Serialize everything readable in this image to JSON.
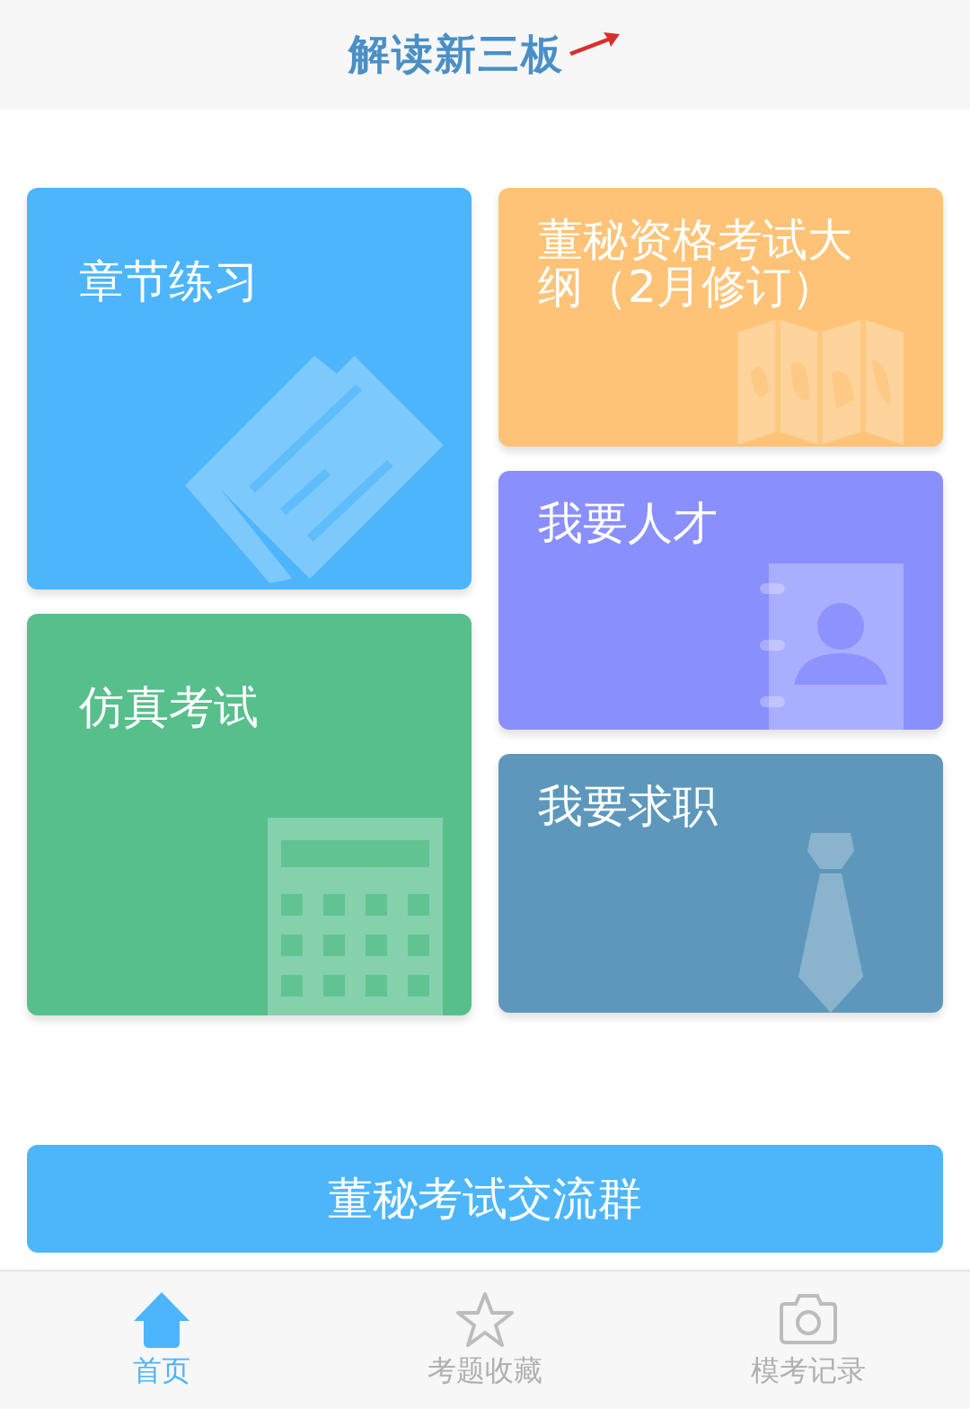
{
  "header": {
    "logo": "解读新三板"
  },
  "left_cards": [
    {
      "title": "章节练习",
      "kind": "document",
      "color": "#4db5fb"
    },
    {
      "title": "仿真考试",
      "kind": "calculator",
      "color": "#57bf8c"
    }
  ],
  "right_cards": [
    {
      "title": "董秘资格考试大纲（2月修订）",
      "kind": "map",
      "color": "#fec376"
    },
    {
      "title": "我要人才",
      "kind": "contact",
      "color": "#8a8ffe"
    },
    {
      "title": "我要求职",
      "kind": "tie",
      "color": "#5d98bc"
    }
  ],
  "group_button": {
    "label": "董秘考试交流群"
  },
  "tabs": [
    {
      "label": "首页",
      "kind": "home",
      "selected": true
    },
    {
      "label": "考题收藏",
      "kind": "star",
      "selected": false
    },
    {
      "label": "模考记录",
      "kind": "camera",
      "selected": false
    }
  ]
}
